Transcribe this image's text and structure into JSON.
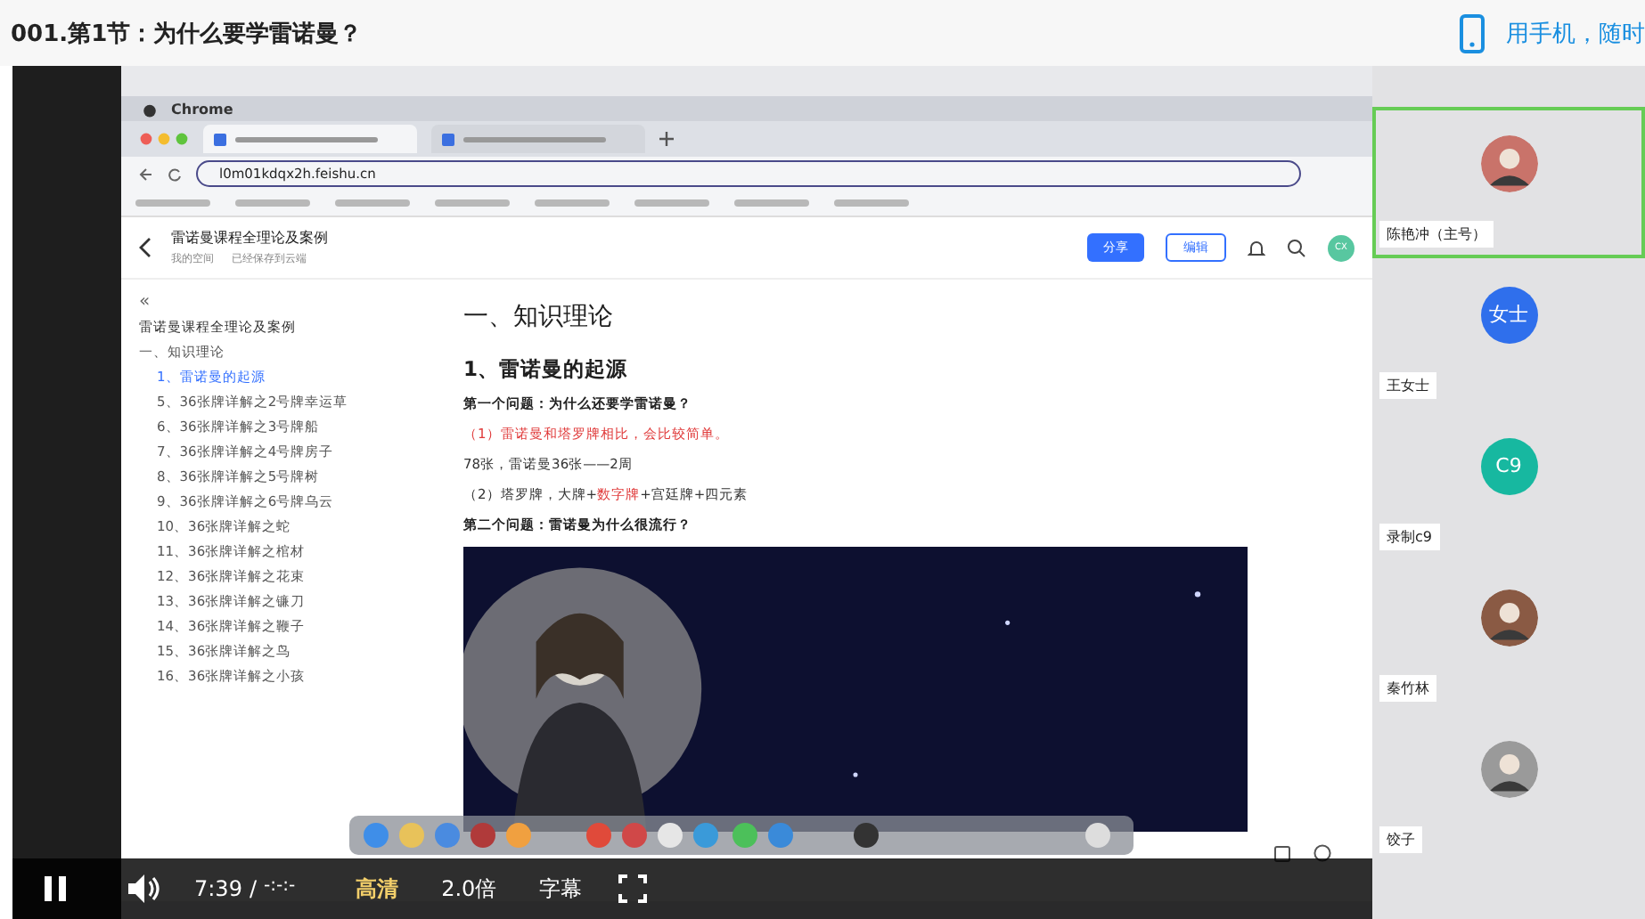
{
  "page": {
    "title": "001.第1节：为什么要学雷诺曼？",
    "mobile_link": "用手机，随时"
  },
  "screen": {
    "menubar": {
      "app": "Chrome"
    },
    "address": "l0m01kdqx2h.feishu.cn",
    "doc": {
      "title": "雷诺曼课程全理论及案例",
      "location": "我的空间",
      "saved": "已经保存到云端",
      "share": "分享",
      "edit": "编辑",
      "avatar": "CX"
    },
    "outline": {
      "collapse": "«",
      "title": "雷诺曼课程全理论及案例",
      "items": [
        {
          "text": "一、知识理论",
          "selected": false,
          "children": [
            {
              "text": "1、雷诺曼的起源",
              "selected": true
            },
            {
              "text": "5、36张牌详解之2号牌幸运草",
              "selected": false
            },
            {
              "text": "6、36张牌详解之3号牌船",
              "selected": false
            },
            {
              "text": "7、36张牌详解之4号牌房子",
              "selected": false
            },
            {
              "text": "8、36张牌详解之5号牌树",
              "selected": false
            },
            {
              "text": "9、36张牌详解之6号牌乌云",
              "selected": false
            },
            {
              "text": "10、36张牌详解之蛇",
              "selected": false
            },
            {
              "text": "11、36张牌详解之棺材",
              "selected": false
            },
            {
              "text": "12、36张牌详解之花束",
              "selected": false
            },
            {
              "text": "13、36张牌详解之镰刀",
              "selected": false
            },
            {
              "text": "14、36张牌详解之鞭子",
              "selected": false
            },
            {
              "text": "15、36张牌详解之鸟",
              "selected": false
            },
            {
              "text": "16、36张牌详解之小孩",
              "selected": false
            }
          ]
        }
      ]
    },
    "blocks": [
      {
        "kind": "h1",
        "text": "一、知识理论"
      },
      {
        "kind": "h2",
        "text": "1、雷诺曼的起源"
      },
      {
        "kind": "question",
        "text": "第一个问题：为什么还要学雷诺曼？"
      },
      {
        "kind": "red",
        "text": "（1）雷诺曼和塔罗牌相比，会比较简单。"
      },
      {
        "kind": "plain",
        "text": "78张，雷诺曼36张——2周"
      },
      {
        "kind": "mixed",
        "parts": [
          {
            "text": "（2）塔罗牌，大牌+",
            "red": false
          },
          {
            "text": "数字牌",
            "red": true
          },
          {
            "text": "+宫廷牌+四元素",
            "red": false
          }
        ]
      },
      {
        "kind": "question",
        "text": "第二个问题：雷诺曼为什么很流行？"
      },
      {
        "kind": "picture"
      }
    ]
  },
  "participants": [
    {
      "name": "陈艳冲（主号）",
      "selected": true,
      "kind": "picture",
      "color": "#c9736a"
    },
    {
      "name": "王女士",
      "selected": false,
      "kind": "initials",
      "initials": "女士",
      "color": "#2f6fec"
    },
    {
      "name": "录制c9",
      "selected": false,
      "kind": "initials",
      "initials": "C9",
      "color": "#17b8a0"
    },
    {
      "name": "秦竹林",
      "selected": false,
      "kind": "picture",
      "color": "#8a5a44"
    },
    {
      "name": "饺子",
      "selected": false,
      "kind": "picture",
      "color": "#9a9a9a"
    }
  ],
  "controls": {
    "playing": true,
    "time": "7:39",
    "separator": "/",
    "duration": "-:-:-",
    "quality": "高清",
    "speed": "2.0倍",
    "subtitles": "字幕"
  }
}
